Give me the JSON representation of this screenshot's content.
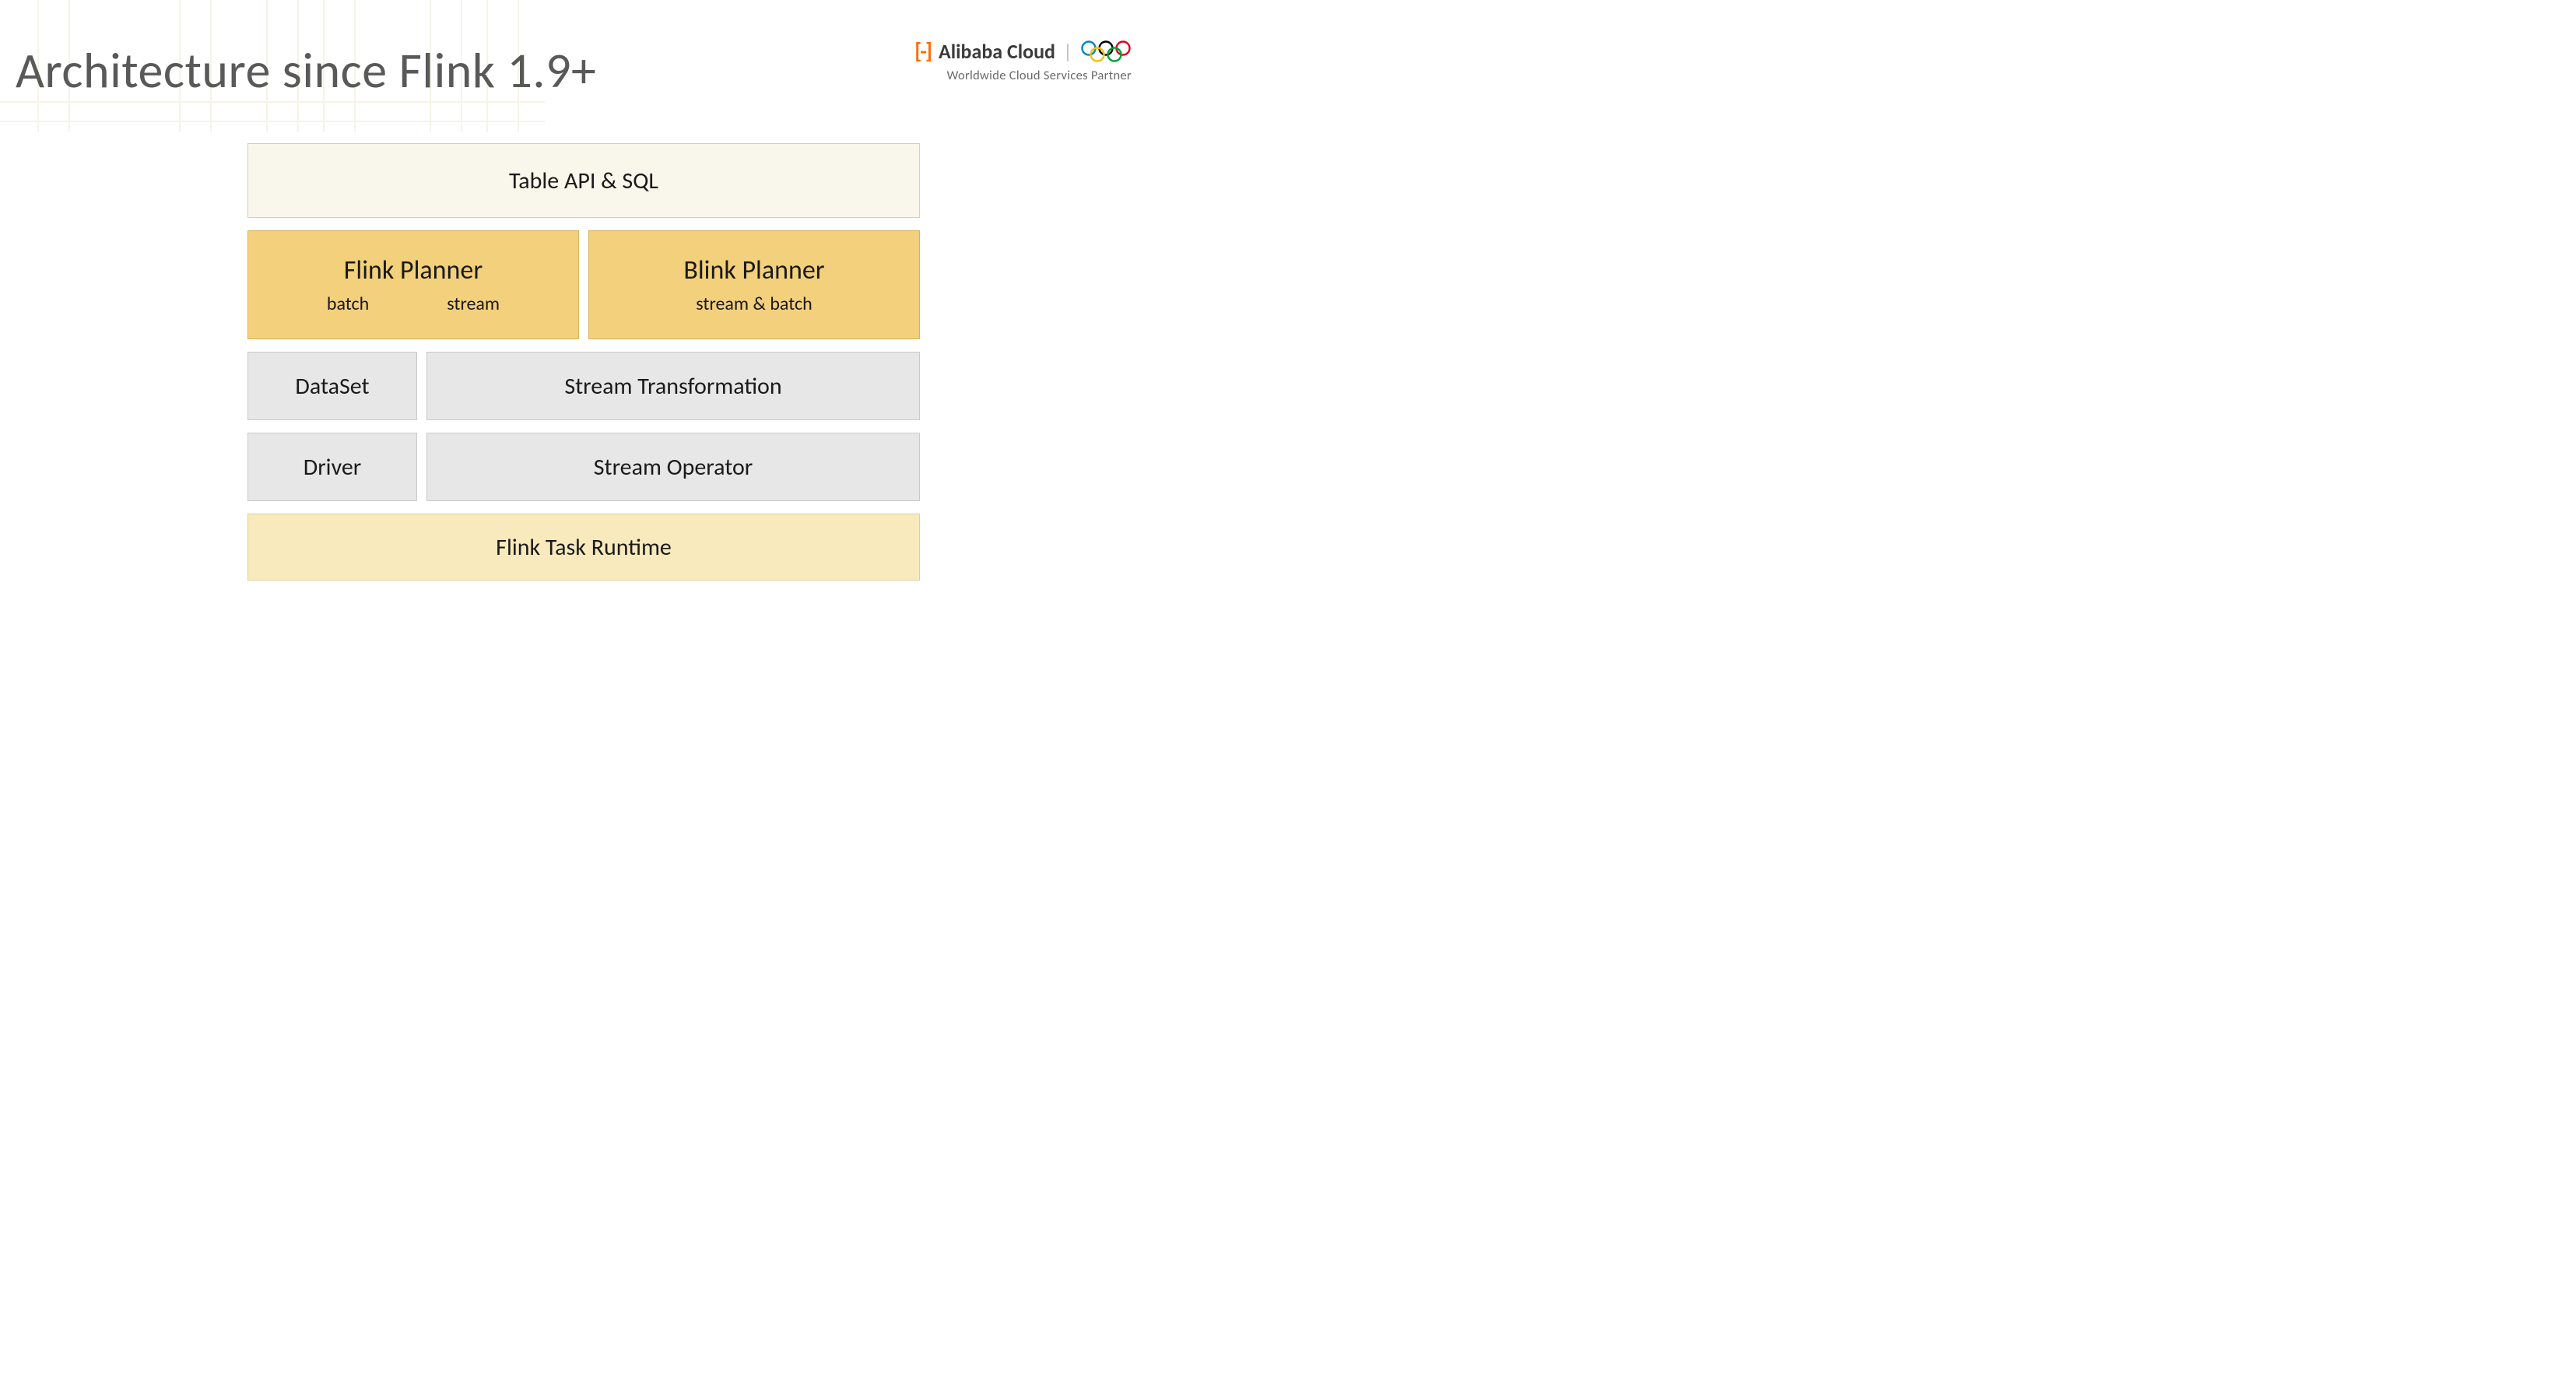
{
  "title": "Architecture since Flink 1.9+",
  "logo": {
    "brand": "Alibaba Cloud",
    "tagline": "Worldwide Cloud Services Partner"
  },
  "diagram": {
    "top": "Table API & SQL",
    "planners": {
      "left": {
        "title": "Flink Planner",
        "mode1": "batch",
        "mode2": "stream"
      },
      "right": {
        "title": "Blink Planner",
        "mode": "stream & batch"
      }
    },
    "row3": {
      "left": "DataSet",
      "right": "Stream Transformation"
    },
    "row4": {
      "left": "Driver",
      "right": "Stream Operator"
    },
    "bottom": "Flink Task Runtime"
  }
}
